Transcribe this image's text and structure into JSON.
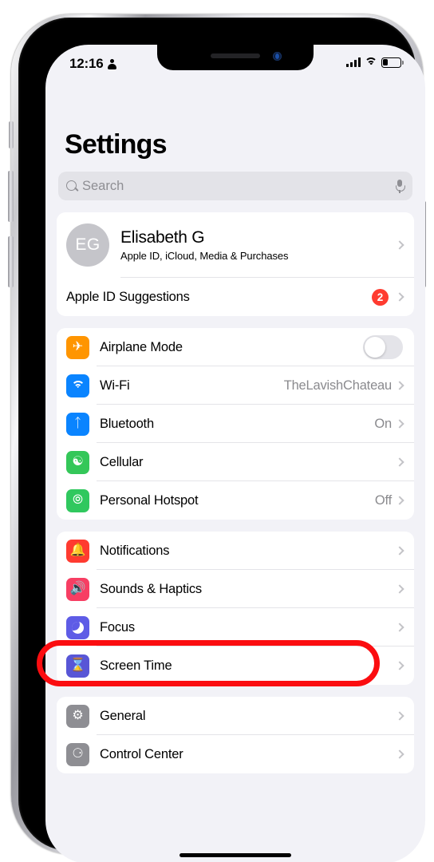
{
  "status_bar": {
    "time": "12:16",
    "person_icon": "person-icon",
    "signal_icon": "cellular-bars-icon",
    "wifi_icon": "wifi-icon",
    "battery_icon": "battery-low-icon"
  },
  "header": {
    "title": "Settings"
  },
  "search": {
    "placeholder": "Search",
    "search_icon": "search-icon",
    "mic_icon": "microphone-icon"
  },
  "account": {
    "initials": "EG",
    "name": "Elisabeth G",
    "subtitle": "Apple ID, iCloud, Media & Purchases",
    "suggestions_label": "Apple ID Suggestions",
    "suggestions_badge": "2"
  },
  "connectivity": [
    {
      "label": "Airplane Mode",
      "value": "",
      "icon": "airplane-icon",
      "control": "toggle",
      "toggle_on": false
    },
    {
      "label": "Wi-Fi",
      "value": "TheLavishChateau",
      "icon": "wifi-icon",
      "control": "chevron"
    },
    {
      "label": "Bluetooth",
      "value": "On",
      "icon": "bluetooth-icon",
      "control": "chevron"
    },
    {
      "label": "Cellular",
      "value": "",
      "icon": "cellular-icon",
      "control": "chevron"
    },
    {
      "label": "Personal Hotspot",
      "value": "Off",
      "icon": "hotspot-icon",
      "control": "chevron"
    }
  ],
  "notifications_group": [
    {
      "label": "Notifications",
      "value": "",
      "icon": "bell-icon"
    },
    {
      "label": "Sounds & Haptics",
      "value": "",
      "icon": "speaker-icon"
    },
    {
      "label": "Focus",
      "value": "",
      "icon": "moon-icon",
      "highlighted": true
    },
    {
      "label": "Screen Time",
      "value": "",
      "icon": "hourglass-icon"
    }
  ],
  "general_group": [
    {
      "label": "General",
      "value": "",
      "icon": "gear-icon"
    },
    {
      "label": "Control Center",
      "value": "",
      "icon": "control-center-icon"
    }
  ],
  "annotation": {
    "target": "Focus",
    "color": "#fb0d10",
    "shape": "rounded-rectangle-outline"
  }
}
